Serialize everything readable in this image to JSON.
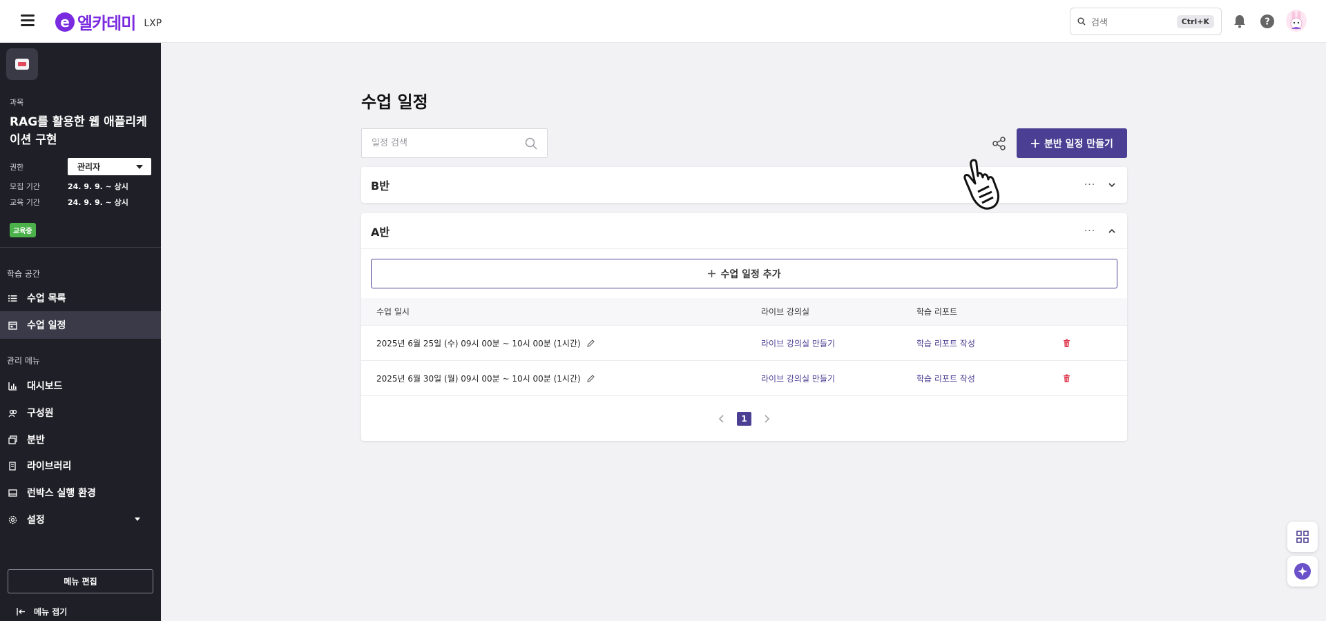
{
  "header": {
    "logo_mark": "e",
    "logo_text": "엘카데미",
    "logo_sub": "LXP",
    "search_placeholder": "검색",
    "search_shortcut": "Ctrl+K"
  },
  "sidebar": {
    "course_label": "과목",
    "course_title": "RAG를 활용한 웹 애플리케이션 구현",
    "role_label": "권한",
    "role_value": "관리자",
    "recruit_label": "모집 기간",
    "recruit_value": "24. 9. 9. ~ 상시",
    "edu_label": "교육 기간",
    "edu_value": "24. 9. 9. ~ 상시",
    "status_badge": "교육중",
    "learning_section": "학습 공간",
    "learning_items": [
      {
        "label": "수업 목록",
        "icon": "list-icon"
      },
      {
        "label": "수업 일정",
        "icon": "calendar-icon"
      }
    ],
    "admin_section": "관리 메뉴",
    "admin_items": [
      {
        "label": "대시보드",
        "icon": "bar-chart-icon"
      },
      {
        "label": "구성원",
        "icon": "members-icon"
      },
      {
        "label": "분반",
        "icon": "class-split-icon"
      },
      {
        "label": "라이브러리",
        "icon": "library-icon"
      },
      {
        "label": "런박스 실행 환경",
        "icon": "runbox-icon"
      },
      {
        "label": "설정",
        "icon": "gear-icon"
      }
    ],
    "menu_edit": "메뉴 편집",
    "menu_fold": "메뉴 접기"
  },
  "main": {
    "title": "수업 일정",
    "search_placeholder": "일정 검색",
    "create_button": "분반 일정 만들기",
    "sections": [
      {
        "name": "B반",
        "expanded": false
      },
      {
        "name": "A반",
        "expanded": true
      }
    ],
    "add_schedule": "수업 일정 추가",
    "columns": [
      "수업 일시",
      "라이브 강의실",
      "학습 리포트"
    ],
    "rows": [
      {
        "datetime": "2025년 6월 25일 (수) 09시 00분 ~ 10시 00분 (1시간)",
        "live": "라이브 강의실 만들기",
        "report": "학습 리포트 작성"
      },
      {
        "datetime": "2025년 6월 30일 (월) 09시 00분 ~ 10시 00분 (1시간)",
        "live": "라이브 강의실 만들기",
        "report": "학습 리포트 작성"
      }
    ],
    "current_page": "1"
  },
  "colors": {
    "brand": "#7a2be0",
    "accent": "#4b3f93",
    "sidebar_bg": "#1f1f27",
    "badge_green": "#4bb14b",
    "danger": "#e0394f"
  }
}
